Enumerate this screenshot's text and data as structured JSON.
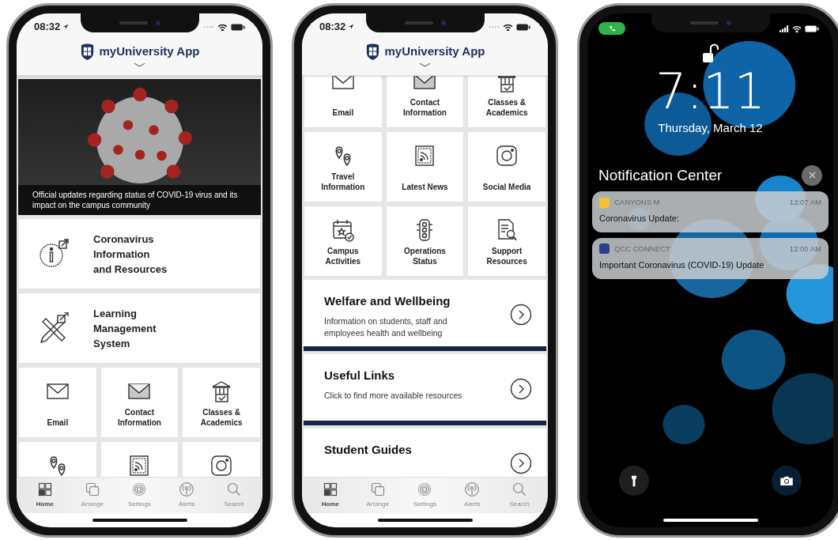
{
  "phones": [
    {
      "kind": "app",
      "status_bar": {
        "time": "08:32"
      },
      "header": {
        "title": "myUniversity App"
      },
      "feature": {
        "caption": "Official updates regarding status of COVID-19 virus and its impact on the campus community"
      },
      "link_cards": [
        {
          "title": "Coronavirus Information and Resources"
        },
        {
          "title": "Learning Management System"
        }
      ],
      "tiles": [
        {
          "kind": "labeled",
          "label": "Email"
        },
        {
          "kind": "labeled",
          "label": "Contact Information"
        },
        {
          "kind": "labeled",
          "label": "Classes & Academics"
        },
        {
          "kind": "icon_only"
        },
        {
          "kind": "icon_only"
        },
        {
          "kind": "icon_only"
        }
      ],
      "tab_bar": [
        {
          "label": "Home",
          "selected": true
        },
        {
          "label": "Arrange",
          "selected": false
        },
        {
          "label": "Settings",
          "selected": false
        },
        {
          "label": "Alerts",
          "selected": false
        },
        {
          "label": "Search",
          "selected": false
        }
      ]
    },
    {
      "kind": "app",
      "status_bar": {
        "time": "08:32"
      },
      "header": {
        "title": "myUniversity App"
      },
      "tiles": [
        {
          "kind": "labeled",
          "label": "Email"
        },
        {
          "kind": "labeled",
          "label": "Contact Information"
        },
        {
          "kind": "labeled",
          "label": "Classes & Academics"
        },
        {
          "kind": "labeled",
          "label": "Travel Information"
        },
        {
          "kind": "labeled",
          "label": "Latest News"
        },
        {
          "kind": "labeled",
          "label": "Social Media"
        },
        {
          "kind": "labeled",
          "label": "Campus Activities"
        },
        {
          "kind": "labeled",
          "label": "Operations Status"
        },
        {
          "kind": "labeled",
          "label": "Support Resources"
        }
      ],
      "info_cards": [
        {
          "title": "Welfare and Wellbeing",
          "subtitle": "Information on students, staff and employees health and wellbeing"
        },
        {
          "title": "Useful Links",
          "subtitle": "Click to find more available resources"
        },
        {
          "title": "Student Guides"
        }
      ],
      "tab_bar": [
        {
          "label": "Home",
          "selected": true
        },
        {
          "label": "Arrange",
          "selected": false
        },
        {
          "label": "Settings",
          "selected": false
        },
        {
          "label": "Alerts",
          "selected": false
        },
        {
          "label": "Search",
          "selected": false
        }
      ]
    },
    {
      "kind": "lock",
      "time": "7:11",
      "date": "Thursday, March 12",
      "notification_center": {
        "title": "Notification Center",
        "notifications": [
          {
            "app": "CANYONS M",
            "time": "12:07 AM",
            "body": "Coronavirus Update:",
            "color": "#f2c230"
          },
          {
            "app": "QCC CONNECT",
            "time": "12:00 AM",
            "body": "Important Coronavirus (COVID-19) Update",
            "color": "#2b3f8a"
          }
        ]
      }
    }
  ]
}
